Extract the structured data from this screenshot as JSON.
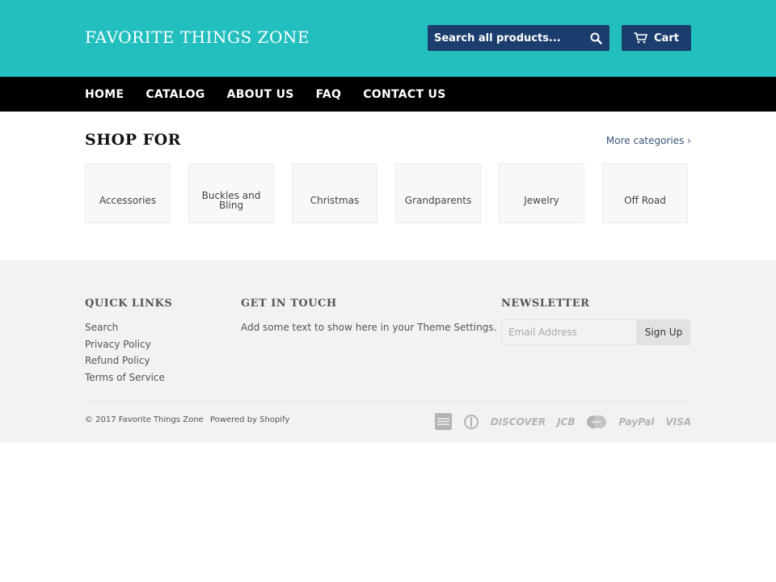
{
  "header": {
    "logo": "FAVORITE THINGS ZONE",
    "search_placeholder": "Search all products...",
    "cart_label": "Cart"
  },
  "nav": {
    "items": [
      "HOME",
      "CATALOG",
      "ABOUT US",
      "FAQ",
      "CONTACT US"
    ]
  },
  "shop": {
    "title": "SHOP FOR",
    "more_label": "More categories ›",
    "categories": [
      "Accessories",
      "Buckles and Bling",
      "Christmas",
      "Grandparents",
      "Jewelry",
      "Off Road"
    ]
  },
  "footer": {
    "quick_links_title": "QUICK LINKS",
    "quick_links": [
      "Search",
      "Privacy Policy",
      "Refund Policy",
      "Terms of Service"
    ],
    "touch_title": "GET IN TOUCH",
    "touch_text": "Add some text to show here in your Theme Settings.",
    "newsletter_title": "NEWSLETTER",
    "email_placeholder": "Email Address",
    "signup_label": "Sign Up",
    "copyright": "© 2017 Favorite Things Zone",
    "powered": "Powered by Shopify",
    "payments": [
      "american-express-icon",
      "diners-club-icon",
      "DISCOVER",
      "JCB",
      "master-icon",
      "PayPal",
      "VISA"
    ]
  },
  "colors": {
    "header_bg": "#22bfbe",
    "button_bg": "#1c3e6e",
    "nav_bg": "#000000",
    "footer_bg": "#f2f2f2"
  }
}
